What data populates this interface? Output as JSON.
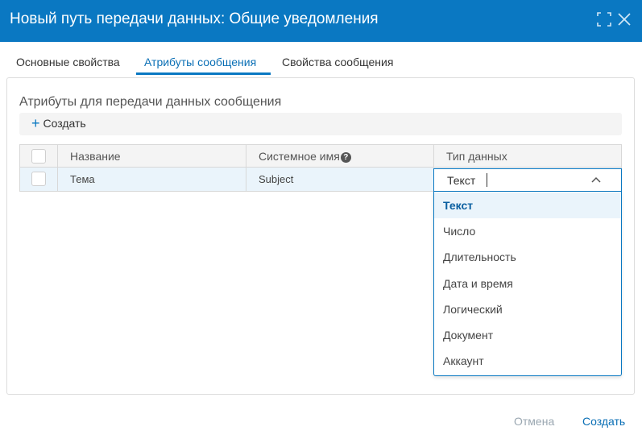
{
  "window": {
    "title": "Новый путь передачи данных: Общие уведомления",
    "icons": {
      "maximize": "maximize-icon",
      "close": "close-icon"
    },
    "header_color": "#0a78c2"
  },
  "tabs": [
    {
      "label": "Основные свойства",
      "active": false
    },
    {
      "label": "Атрибуты сообщения",
      "active": true
    },
    {
      "label": "Свойства сообщения",
      "active": false
    }
  ],
  "section": {
    "title": "Атрибуты для передачи данных сообщения",
    "create_label": "Создать",
    "create_icon": "plus-icon"
  },
  "grid": {
    "columns": [
      "Название",
      "Системное имя",
      "Тип данных"
    ],
    "help_icon": "question-icon",
    "rows": [
      {
        "name": "Тема",
        "system_name": "Subject",
        "data_type": "Текст"
      }
    ]
  },
  "dropdown": {
    "selected": "Текст",
    "options": [
      "Текст",
      "Число",
      "Длительность",
      "Дата и время",
      "Логический",
      "Документ",
      "Аккаунт"
    ]
  },
  "footer": {
    "cancel_label": "Отмена",
    "submit_label": "Создать"
  },
  "colors": {
    "accent": "#0a78c2",
    "row_highlight": "#eaf4fb",
    "disabled_text": "#9aa7b1"
  }
}
